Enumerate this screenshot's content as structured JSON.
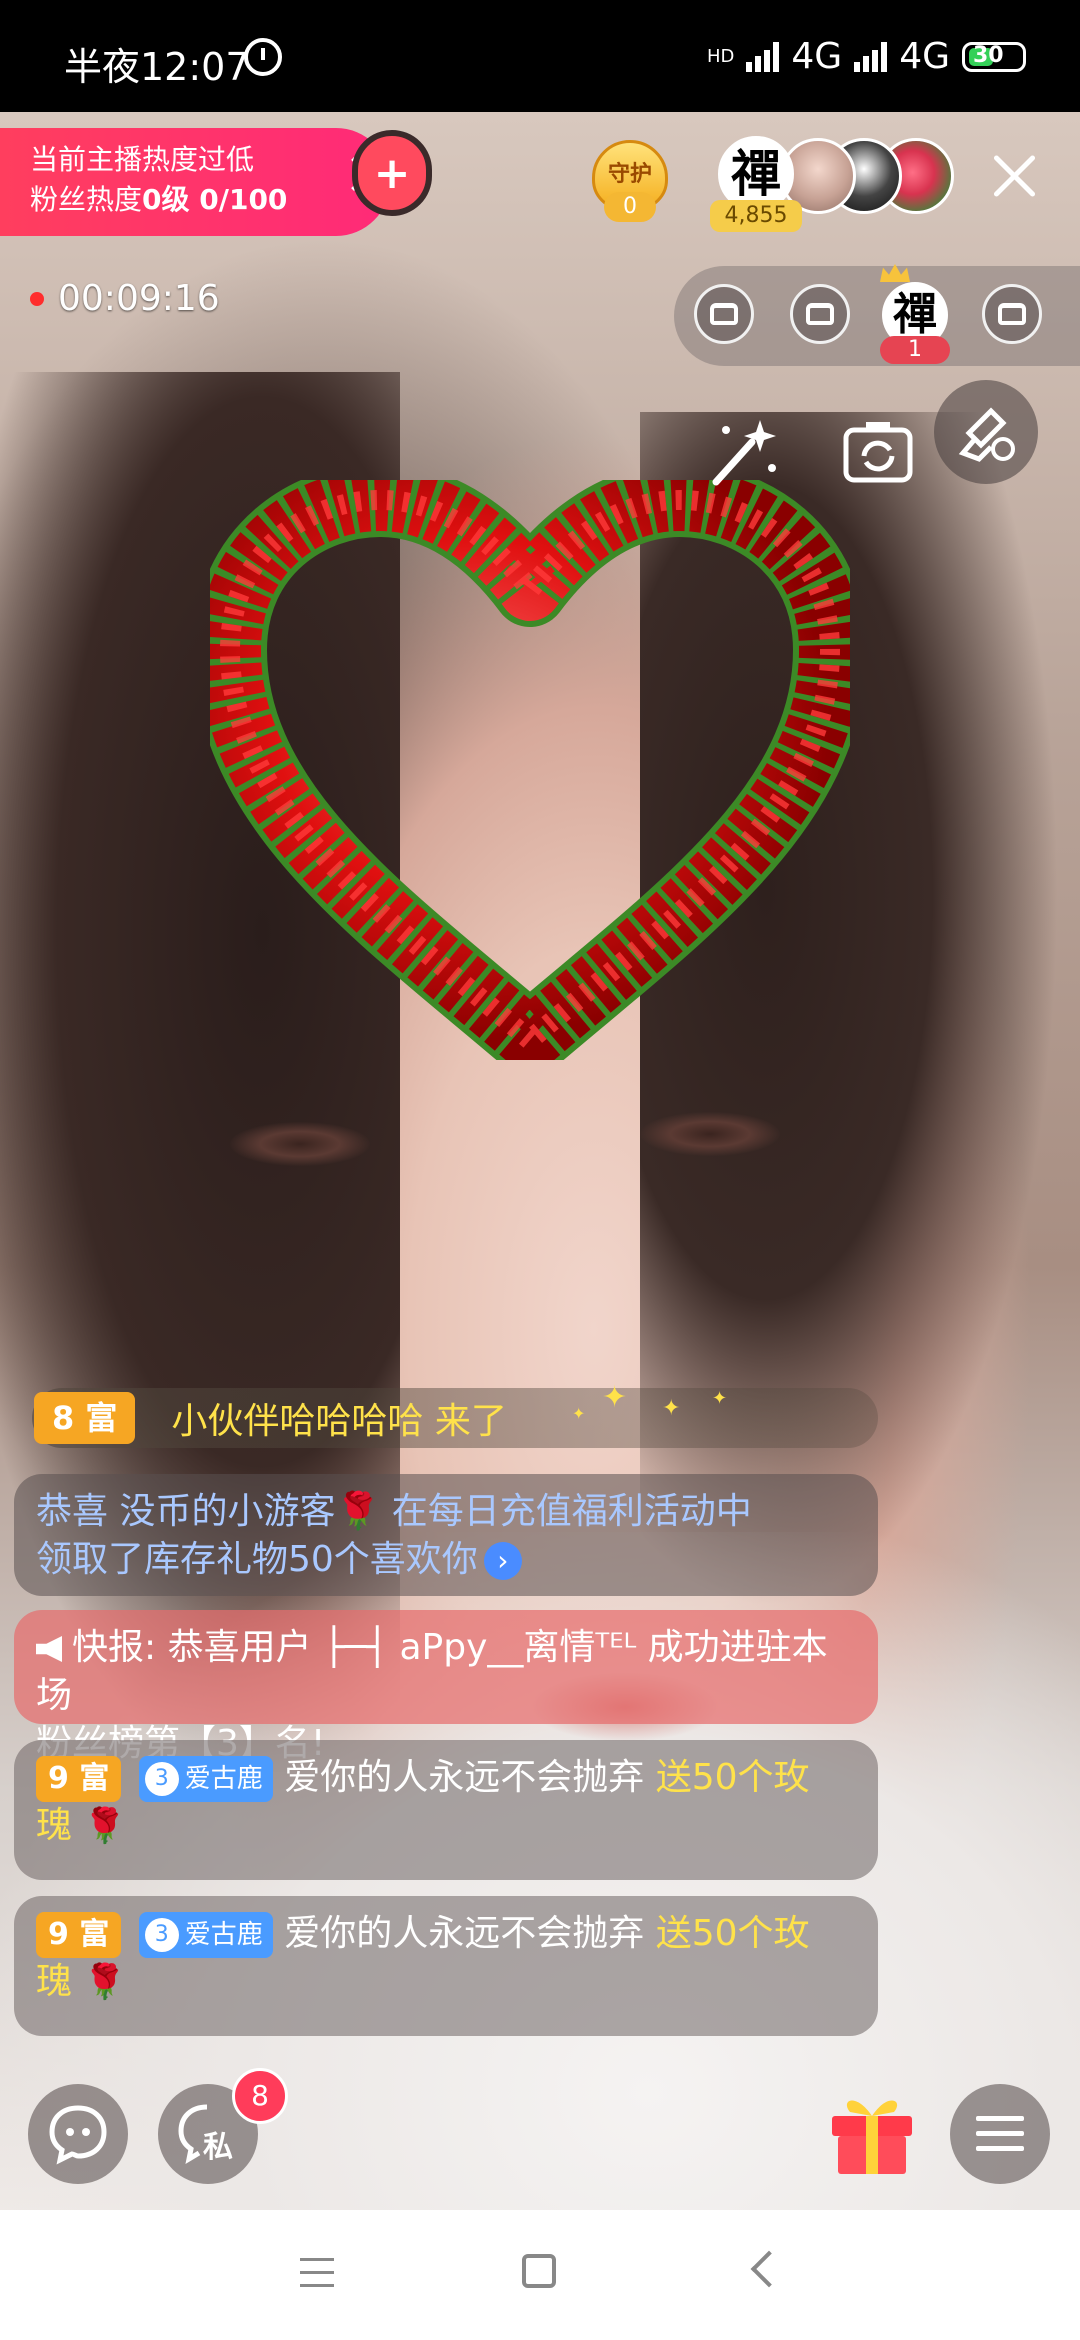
{
  "status_bar": {
    "time": "半夜12:07",
    "network_1": "4G",
    "network_2": "4G",
    "hd_label": "HD",
    "battery": "30"
  },
  "heat_banner": {
    "line1": "当前主播热度过低",
    "line2_prefix": "粉丝热度",
    "line2_level": "0级",
    "line2_progress": "0/100"
  },
  "timer": "00:09:16",
  "guard": {
    "label": "守护",
    "count": "0"
  },
  "host_avatar_char": "禪",
  "viewer_count": "4,855",
  "seats": {
    "occupant_char": "禪",
    "occupant_count": "1"
  },
  "chat": {
    "join": {
      "level": "8 富",
      "text": "小伙伴哈哈哈哈 来了"
    },
    "system": {
      "text_line1": "恭喜 没币的小游客🌹 在每日充值福利活动中",
      "text_line2": "领取了库存礼物50个喜欢你",
      "arrow": "›"
    },
    "news": {
      "text_line1": "快报: 恭喜用户 ├─┤ aPpy__离情ᵀᴱᴸ 成功进驻本场",
      "text_line2": "粉丝榜第【3】名!"
    },
    "gifts": [
      {
        "level": "9 富",
        "club_level": "3",
        "club_name": "爱古鹿",
        "message": "爱你的人永远不会抛弃",
        "action": "送50个玫瑰",
        "action_tail": "瑰"
      },
      {
        "level": "9 富",
        "club_level": "3",
        "club_name": "爱古鹿",
        "message": "爱你的人永远不会抛弃",
        "action": "送50个玫瑰",
        "action_tail": "瑰"
      }
    ]
  },
  "private_badge": "8",
  "private_label": "私",
  "icons": {
    "alarm": "alarm-icon",
    "chat": "chat-bubble-icon",
    "private": "private-message-icon",
    "gift": "gift-icon",
    "menu": "menu-icon",
    "close": "close-icon",
    "beauty": "beauty-wand-icon",
    "flip": "camera-flip-icon",
    "clean": "clean-screen-icon"
  },
  "colors": {
    "heat_banner": "#ff2a78",
    "level_badge": "#f6a623",
    "gift_action": "#ffe24a",
    "club_badge": "#4a9bff"
  }
}
